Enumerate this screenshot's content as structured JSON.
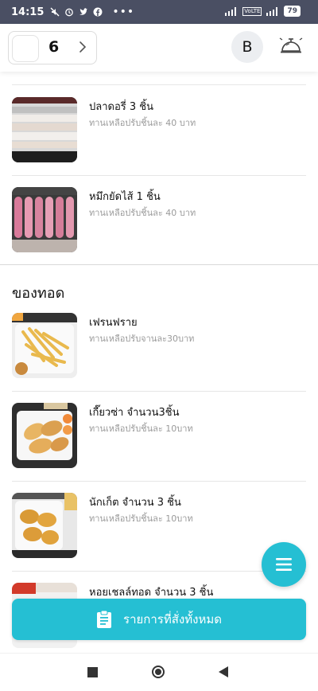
{
  "status_bar": {
    "time": "14:15",
    "network_left": "VoLTE",
    "battery": "79"
  },
  "header": {
    "table_number": "6",
    "avatar_letter": "B"
  },
  "menu": {
    "items_top": [
      {
        "name": "ปลาดอรี่ 3 ชิ้น",
        "desc": "ทานเหลือปรับชิ้นละ 40 บาท"
      },
      {
        "name": "หมึกยัดไส้ 1 ชิ้น",
        "desc": "ทานเหลือปรับชิ้นละ 40 บาท"
      }
    ],
    "section_fried": {
      "title": "ของทอด",
      "items": [
        {
          "name": "เฟรนฟราย",
          "desc": "ทานเหลือปรับจานละ30บาท"
        },
        {
          "name": "เกี๊ยวซ่า จำนวน3ชิ้น",
          "desc": "ทานเหลือปรับชิ้นละ 10บาท"
        },
        {
          "name": "นักเก็ต จำนวน 3 ชิ้น",
          "desc": "ทานเหลือปรับชิ้นละ 10บาท"
        },
        {
          "name": "หอยเชลล์ทอด จำนวน 3 ชิ้น",
          "desc": ""
        }
      ]
    }
  },
  "order_button": {
    "label": "รายการที่สั่งทั้งหมด"
  },
  "colors": {
    "accent": "#25bfd3",
    "status_bar": "#4a4f63"
  }
}
